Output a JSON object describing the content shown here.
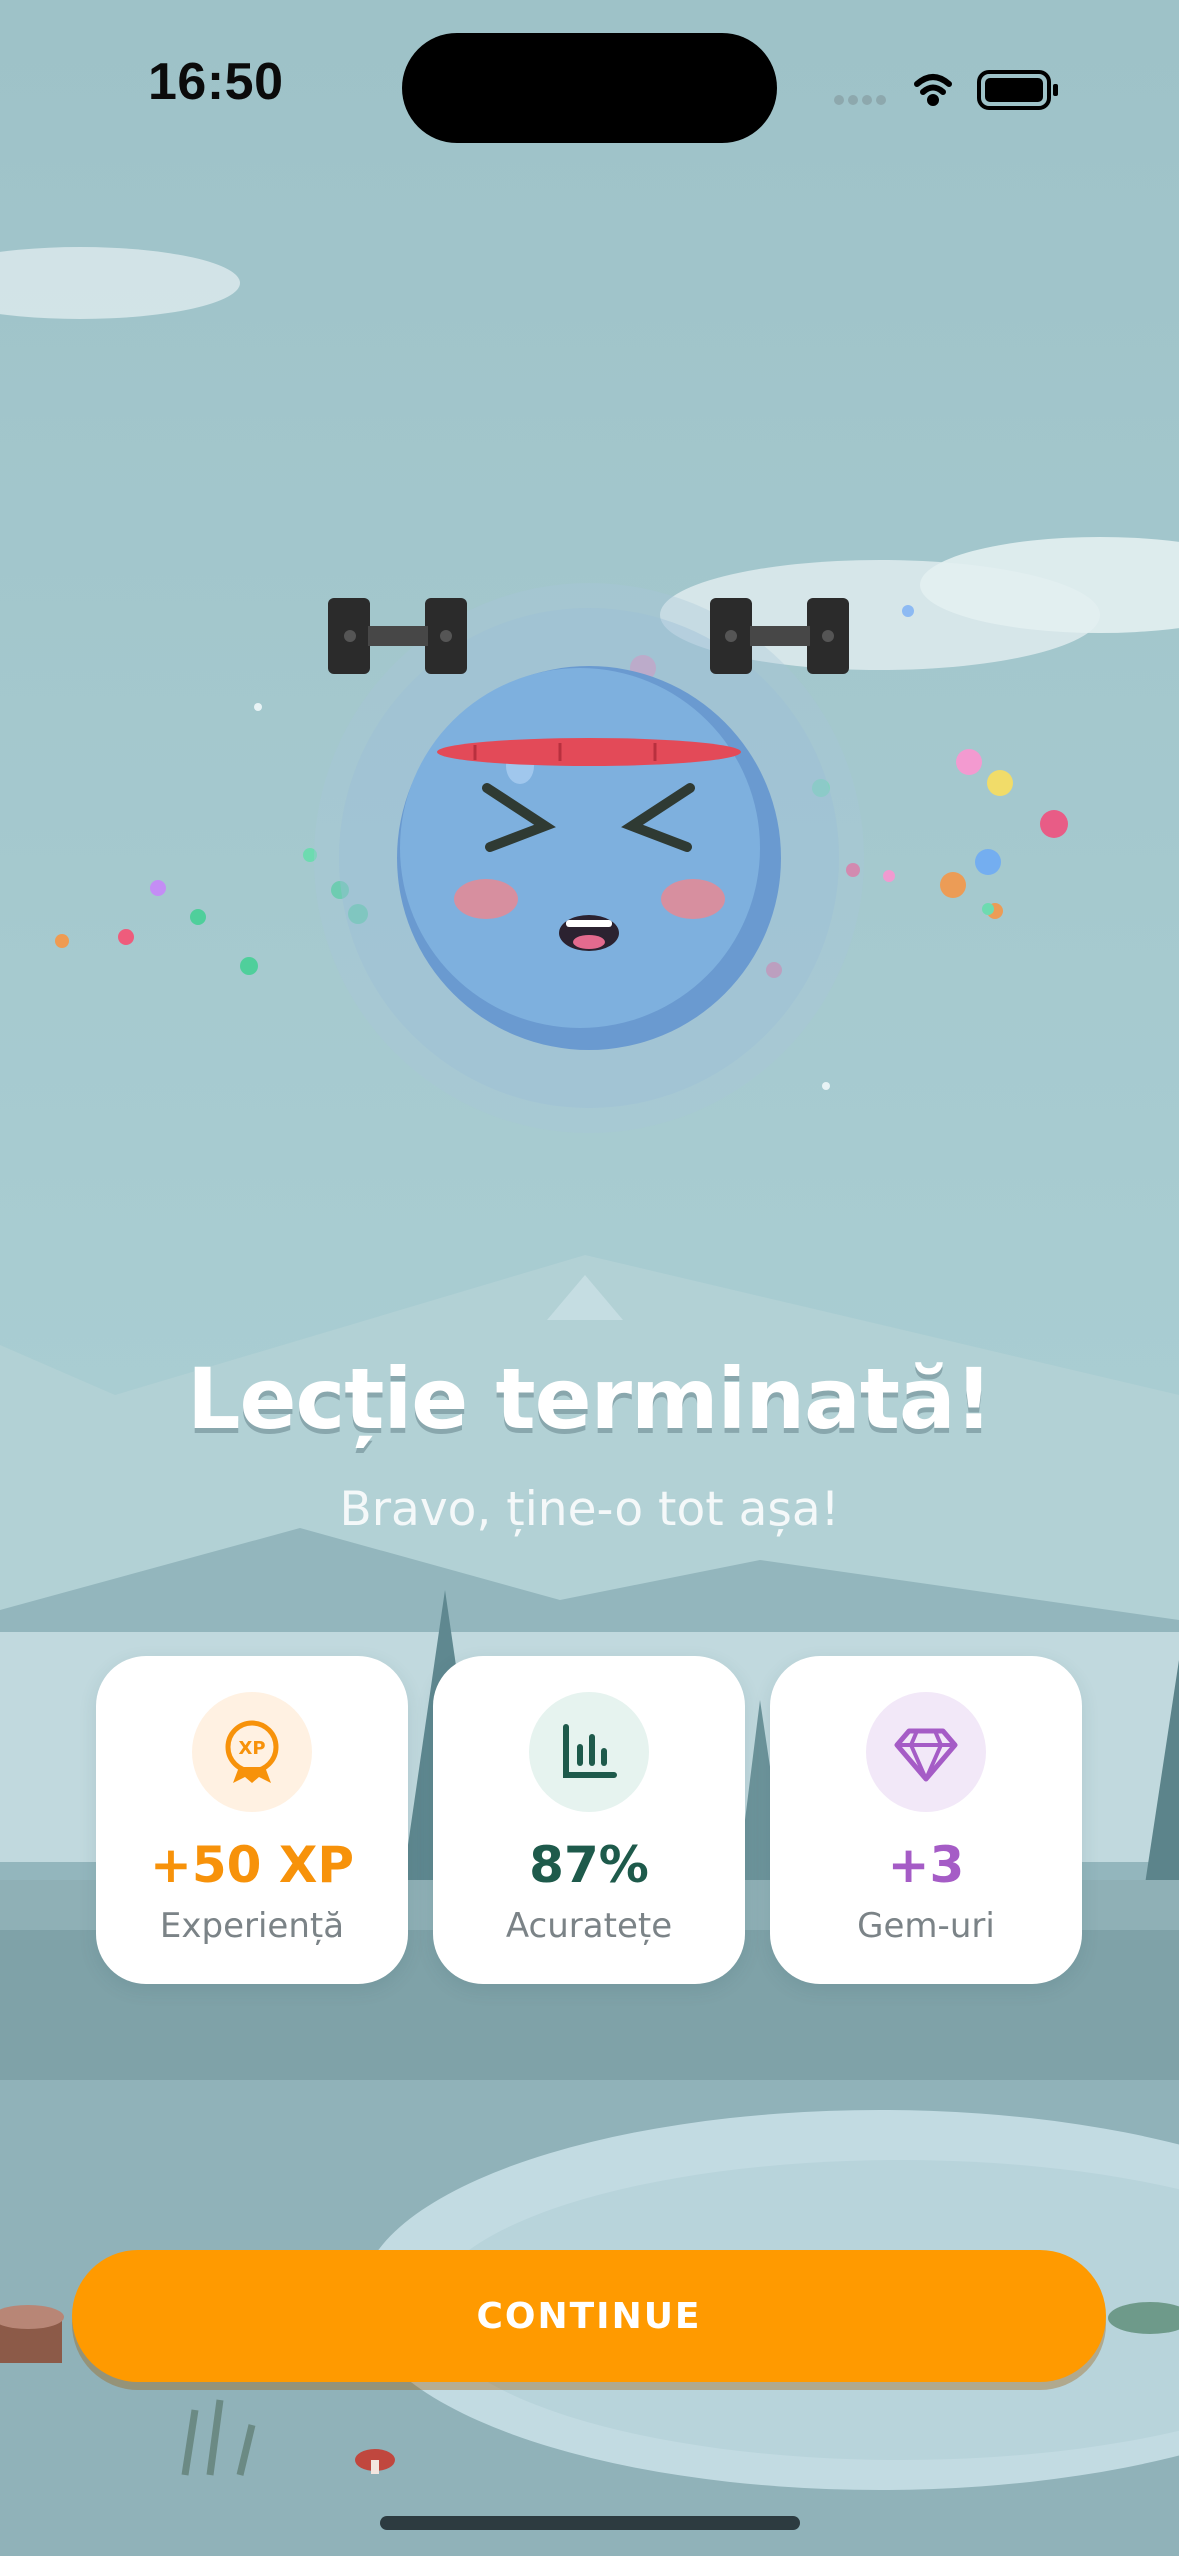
{
  "status_bar": {
    "time": "16:50"
  },
  "lesson_complete": {
    "title": "Lecție terminată!",
    "subtitle": "Bravo, ține-o tot așa!"
  },
  "stats": [
    {
      "icon": "xp-medal-icon",
      "value": "+50 XP",
      "label": "Experiență",
      "color": "#f7920a",
      "icon_bg": "#fff1e2"
    },
    {
      "icon": "bar-chart-icon",
      "value": "87%",
      "label": "Acuratețe",
      "color": "#1e5a4b",
      "icon_bg": "#e6f3ef"
    },
    {
      "icon": "gem-icon",
      "value": "+3",
      "label": "Gem-uri",
      "color": "#a55cc6",
      "icon_bg": "#f2e8f8"
    }
  ],
  "actions": {
    "continue_label": "CONTINUE"
  },
  "colors": {
    "accent": "#ff9a00",
    "sky": "#9fc3c9",
    "mascot": "#78a9d9"
  }
}
